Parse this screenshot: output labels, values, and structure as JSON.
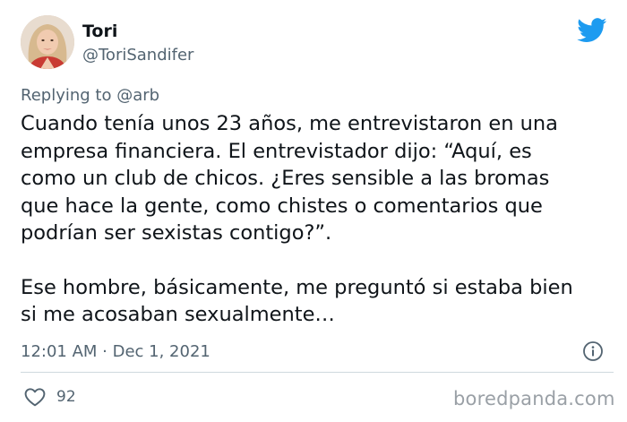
{
  "author": {
    "display_name": "Tori",
    "handle": "@ToriSandifer",
    "avatar_icon": "user-avatar-photo"
  },
  "reply": {
    "text": "Replying to @arb"
  },
  "tweet": {
    "paragraph1_lines": [
      "Cuando tenía unos 23 años, me entrevistaron en una",
      "empresa financiera. El entrevistador dijo: “Aquí, es",
      "como un club de chicos. ¿Eres sensible a las bromas",
      "que hace la gente, como chistes o comentarios que",
      "podrían ser sexistas contigo?”."
    ],
    "paragraph2_lines": [
      "Ese hombre, básicamente, me preguntó si estaba bien",
      "si me acosaban sexualmente…"
    ]
  },
  "meta": {
    "timestamp": "12:01 AM · Dec 1, 2021"
  },
  "engagement": {
    "likes": "92"
  },
  "icons": {
    "twitter": "twitter-bird-icon",
    "info": "info-icon",
    "like": "heart-icon"
  },
  "watermark": {
    "text": "boredpanda.com"
  },
  "colors": {
    "twitter_blue": "#1d9bf0",
    "text_primary": "#0f1419",
    "text_secondary": "#536471",
    "divider": "#cfd9de",
    "watermark": "#9aa0a6"
  }
}
